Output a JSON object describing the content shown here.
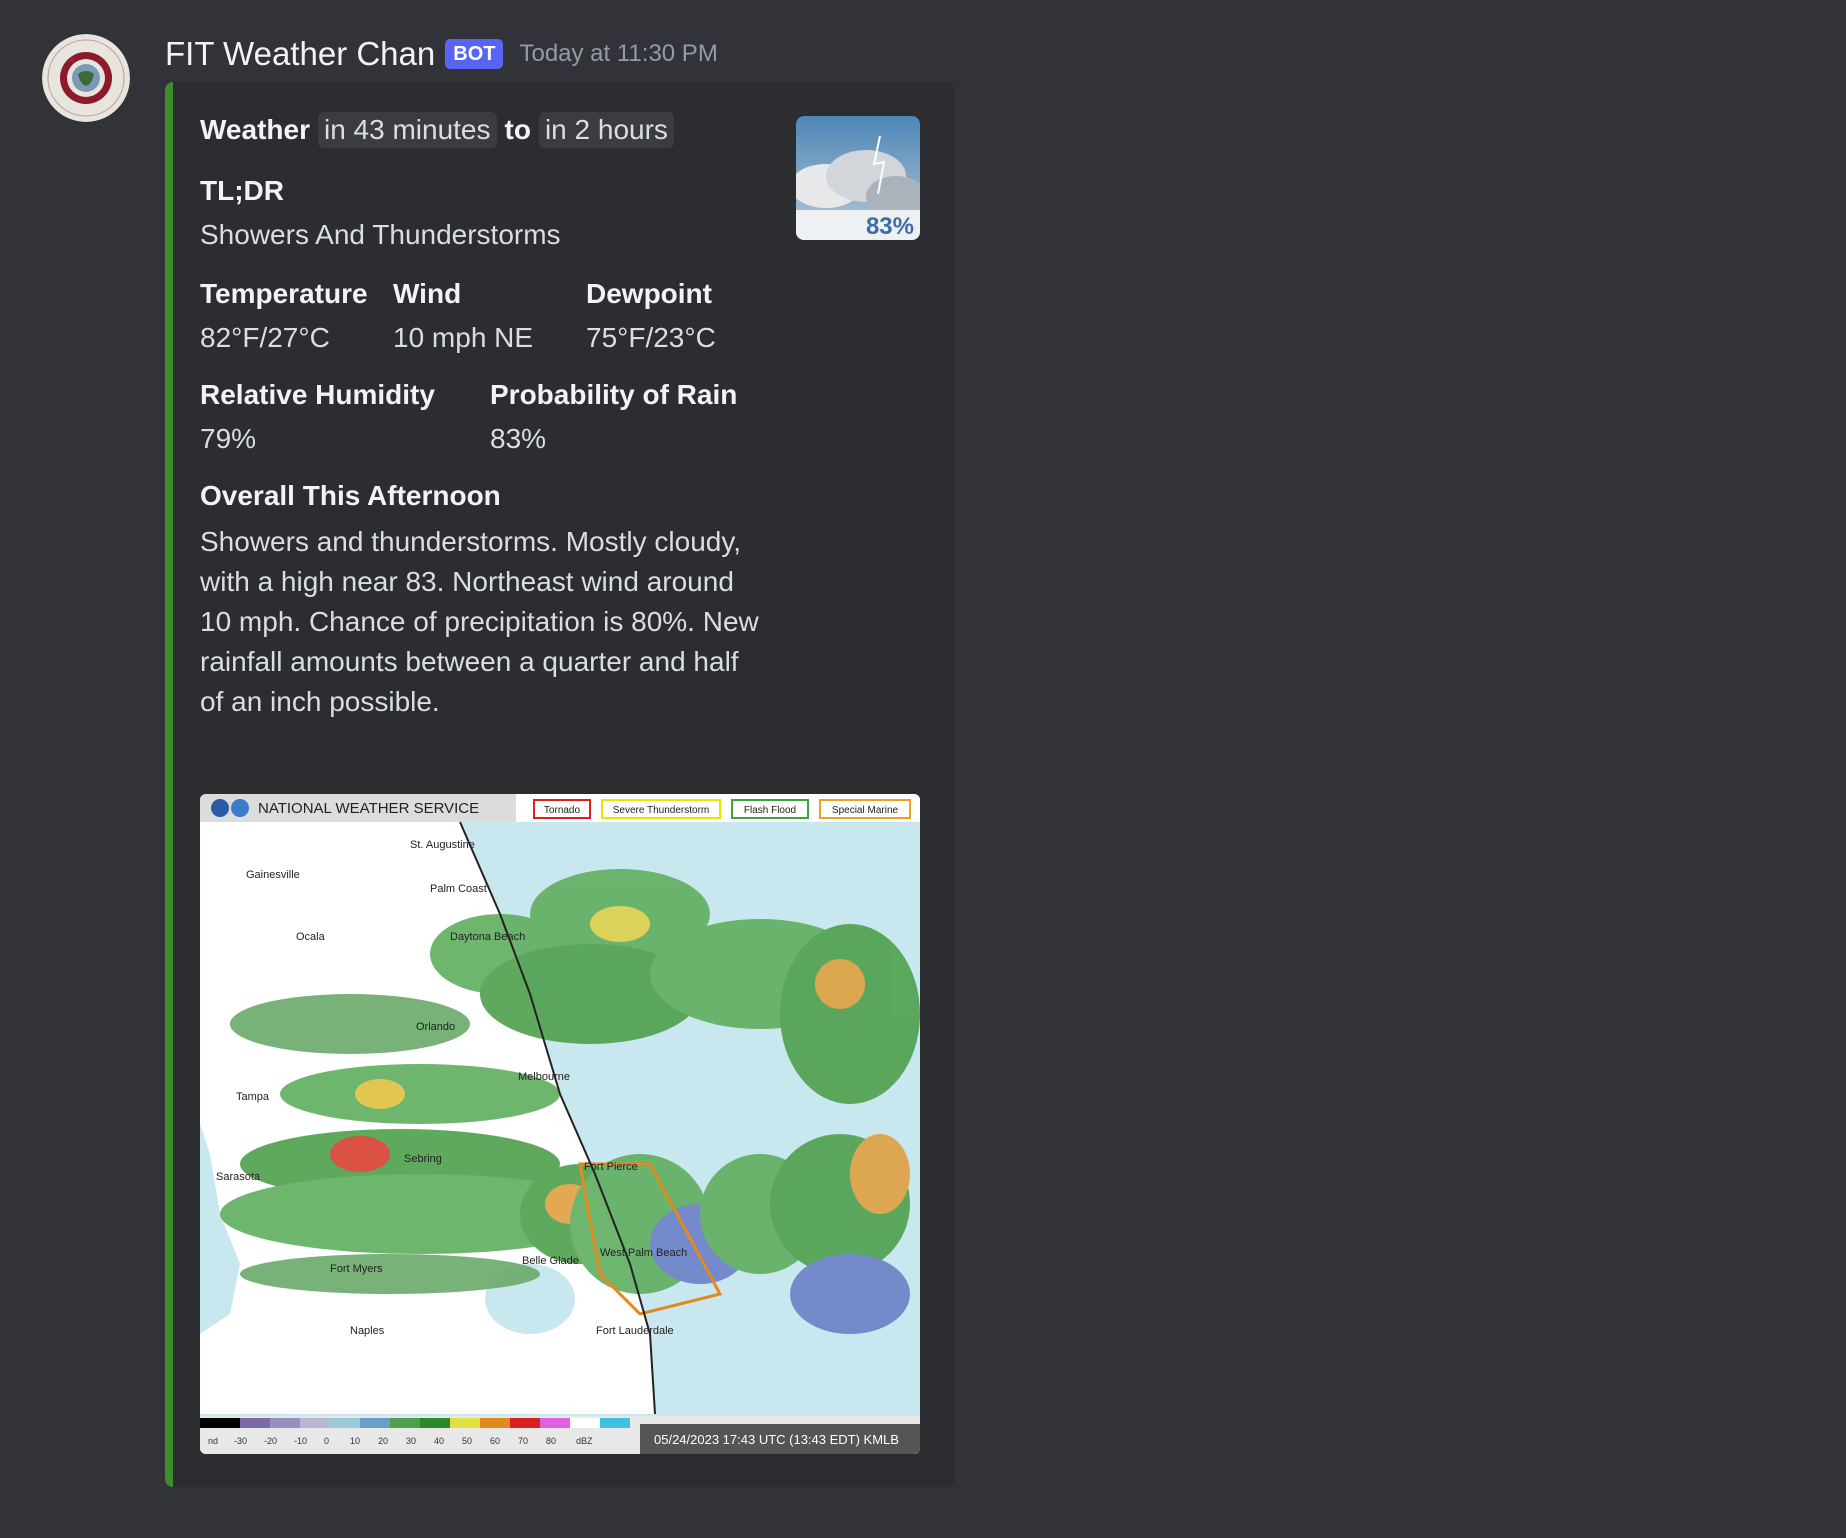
{
  "message": {
    "username": "FIT Weather Chan",
    "bot_tag": "BOT",
    "timestamp": "Today at 11:30 PM"
  },
  "embed": {
    "title_prefix": "Weather",
    "time_from": "in 43 minutes",
    "to_word": "to",
    "time_to": "in 2 hours",
    "tldr_label": "TL;DR",
    "tldr_value": "Showers And Thunderstorms",
    "fields": {
      "temperature": {
        "name": "Temperature",
        "value": "82°F/27°C"
      },
      "wind": {
        "name": "Wind",
        "value": "10 mph NE"
      },
      "dewpoint": {
        "name": "Dewpoint",
        "value": "75°F/23°C"
      },
      "humidity": {
        "name": "Relative Humidity",
        "value": "79%"
      },
      "rain": {
        "name": "Probability of Rain",
        "value": "83%"
      }
    },
    "overall_label": "Overall This Afternoon",
    "overall_text": "Showers and thunderstorms. Mostly cloudy, with a high near 83. Northeast wind around 10 mph. Chance of precipitation is 80%. New rainfall amounts between a quarter and half of an inch possible.",
    "thumbnail_percent": "83%",
    "map": {
      "header": "NATIONAL WEATHER SERVICE",
      "legend": [
        "Tornado",
        "Severe Thunderstorm",
        "Flash Flood",
        "Special Marine"
      ],
      "legend_colors": [
        "#e02020",
        "#e6e600",
        "#3fa23f",
        "#f0a020"
      ],
      "cities": [
        "St. Augustine",
        "Gainesville",
        "Palm Coast",
        "Ocala",
        "Daytona Beach",
        "Orlando",
        "Melbourne",
        "Tampa",
        "Sebring",
        "Fort Pierce",
        "Sarasota",
        "West Palm Beach",
        "Belle Glade",
        "Fort Myers",
        "Naples",
        "Fort Lauderdale"
      ],
      "scale_labels": [
        "nd",
        "-30",
        "-20",
        "-10",
        "0",
        "10",
        "20",
        "30",
        "40",
        "50",
        "60",
        "70",
        "80",
        "dBZ"
      ],
      "footer": "05/24/2023 17:43 UTC (13:43 EDT) KMLB"
    }
  }
}
